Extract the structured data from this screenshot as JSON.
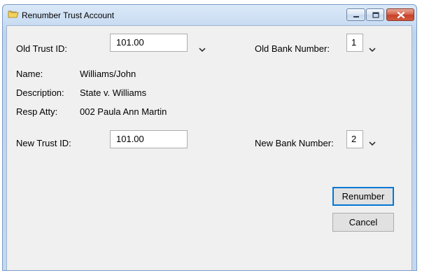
{
  "window": {
    "title": "Renumber Trust Account",
    "title_icon": "folder-icon",
    "controls": [
      "minimize-icon",
      "maximize-icon",
      "close-icon"
    ]
  },
  "old_trust": {
    "label": "Old Trust ID:",
    "value": "101.00"
  },
  "old_bank": {
    "label": "Old Bank Number:",
    "value": "1"
  },
  "details": {
    "name_label": "Name:",
    "name_value": "Williams/John",
    "description_label": "Description:",
    "description_value": "State v. Williams",
    "resp_atty_label": "Resp Atty:",
    "resp_atty_value": "002 Paula Ann Martin"
  },
  "new_trust": {
    "label": "New Trust ID:",
    "value": "101.00"
  },
  "new_bank": {
    "label": "New Bank Number:",
    "value": "2"
  },
  "buttons": {
    "renumber": "Renumber",
    "cancel": "Cancel"
  },
  "colors": {
    "title_gradient_top": "#dbe9f8",
    "client_background": "#f0f0f0",
    "close_button": "#c7412b",
    "default_button_border": "#0078d7",
    "button_face": "#e1e1e1"
  }
}
